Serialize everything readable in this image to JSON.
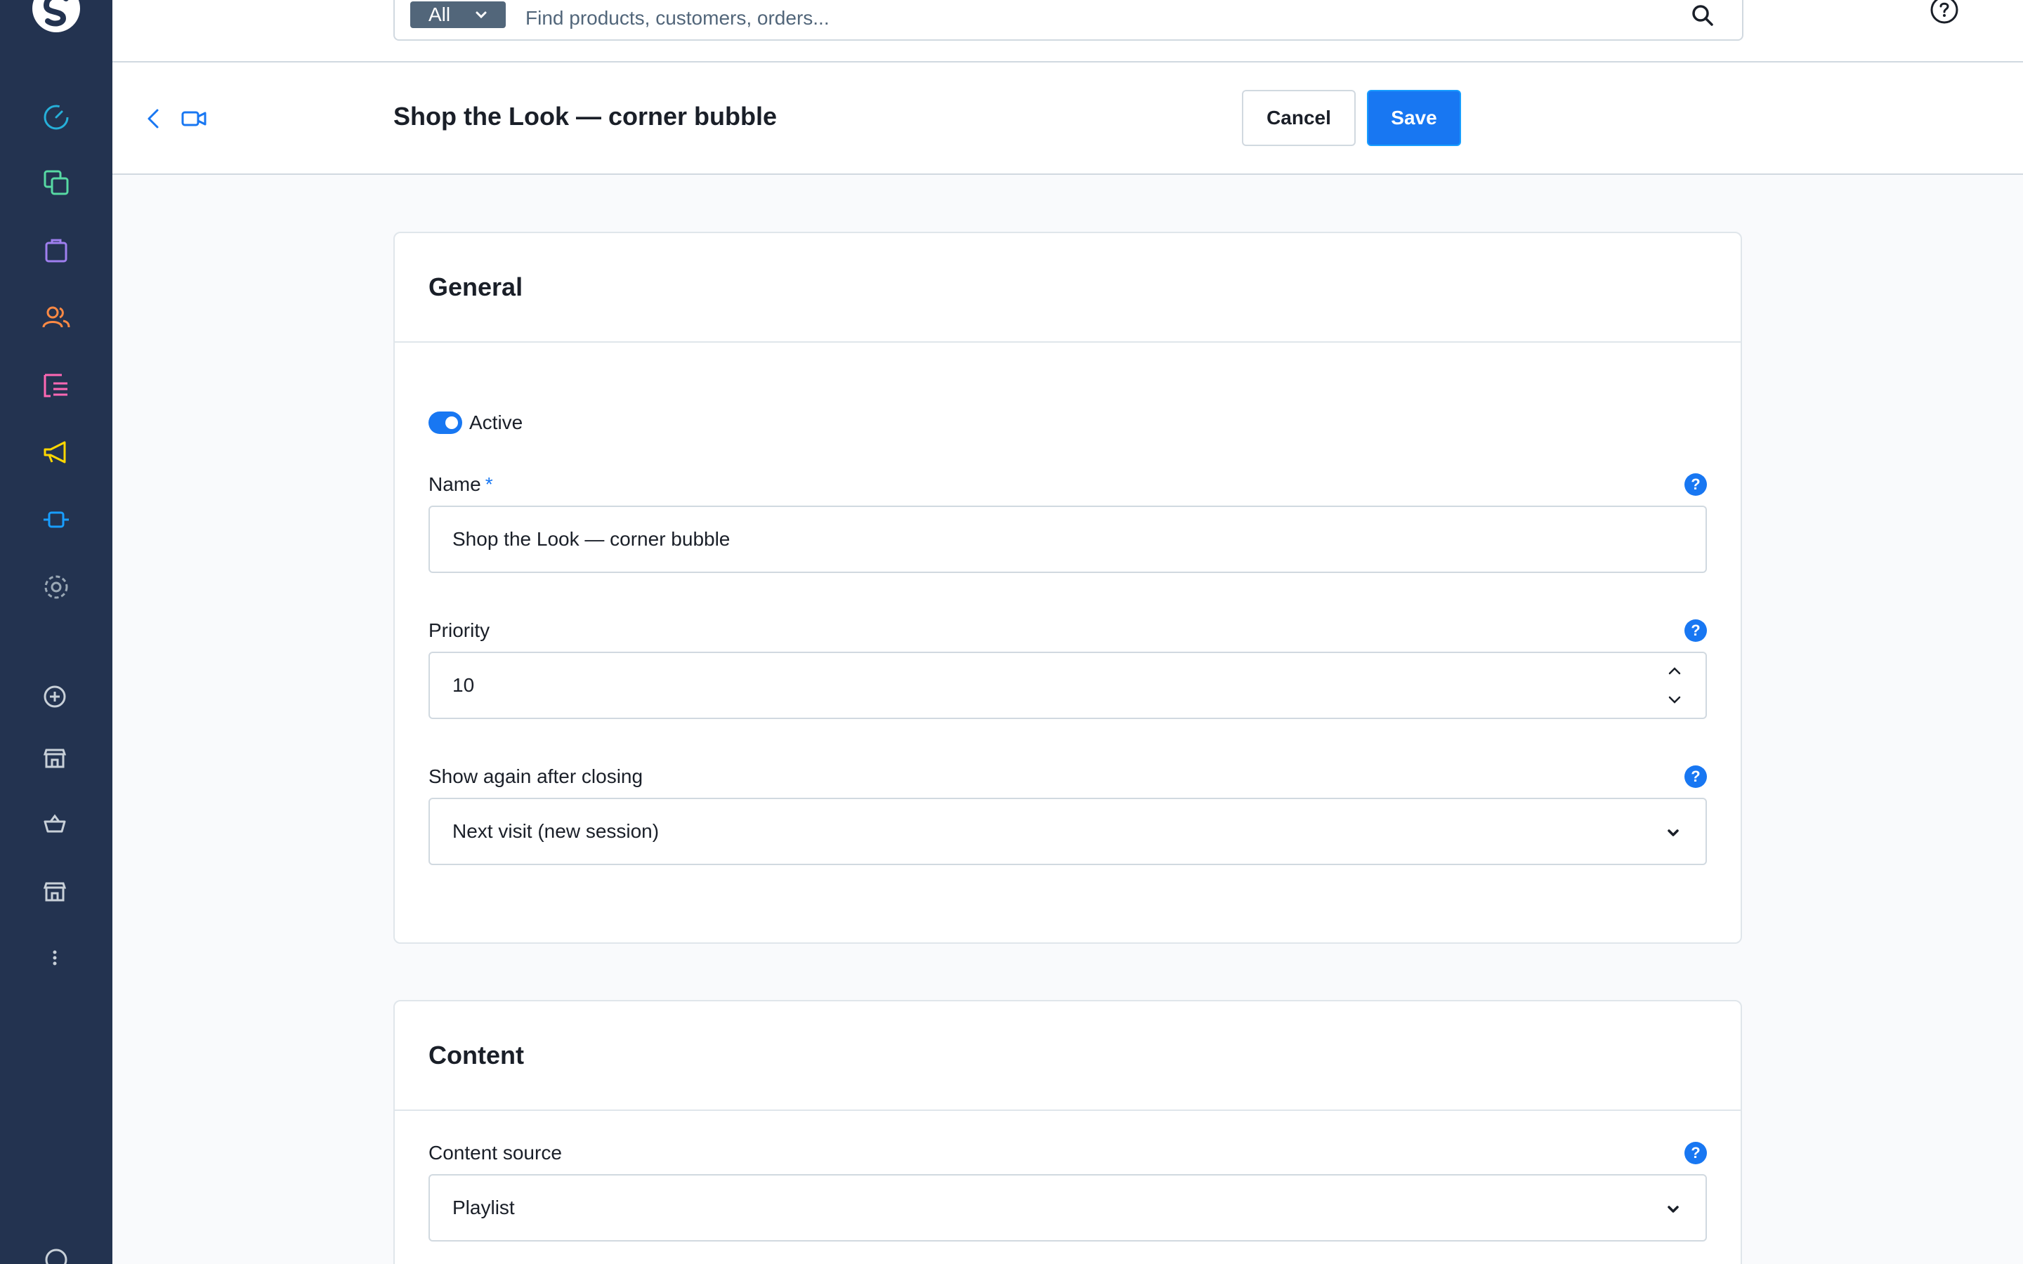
{
  "search": {
    "type_label": "All",
    "placeholder": "Find products, customers, orders..."
  },
  "sidebar": {
    "items": [
      {
        "icon": "dashboard-icon",
        "color": "#26b0d9"
      },
      {
        "icon": "catalogue-icon",
        "color": "#57d9a3"
      },
      {
        "icon": "orders-icon",
        "color": "#9f7fef"
      },
      {
        "icon": "customers-icon",
        "color": "#ff8a44"
      },
      {
        "icon": "content-icon",
        "color": "#ff68b4"
      },
      {
        "icon": "marketing-icon",
        "color": "#ffd700"
      },
      {
        "icon": "extensions-icon",
        "color": "#189eff"
      },
      {
        "icon": "settings-icon",
        "color": "#9aa8b5"
      },
      {
        "icon": "add-sales-channel-icon",
        "color": "#c8d0d8"
      },
      {
        "icon": "storefront-icon",
        "color": "#c8d0d8"
      },
      {
        "icon": "headless-icon",
        "color": "#c8d0d8"
      },
      {
        "icon": "storefront-2-icon",
        "color": "#c8d0d8"
      },
      {
        "icon": "more-icon",
        "color": "#c8d0d8"
      }
    ]
  },
  "header": {
    "title": "Shop the Look — corner bubble",
    "cancel_label": "Cancel",
    "save_label": "Save"
  },
  "general": {
    "title": "General",
    "active_label": "Active",
    "active": true,
    "name_label": "Name",
    "name_required_mark": "*",
    "name_value": "Shop the Look — corner bubble",
    "priority_label": "Priority",
    "priority_value": "10",
    "show_again_label": "Show again after closing",
    "show_again_value": "Next visit (new session)"
  },
  "content": {
    "title": "Content",
    "source_label": "Content source",
    "source_value": "Playlist"
  },
  "help_symbol": "?",
  "colors": {
    "sidebar_bg": "#233350",
    "primary": "#1877f2",
    "border": "#d1d9e0"
  }
}
